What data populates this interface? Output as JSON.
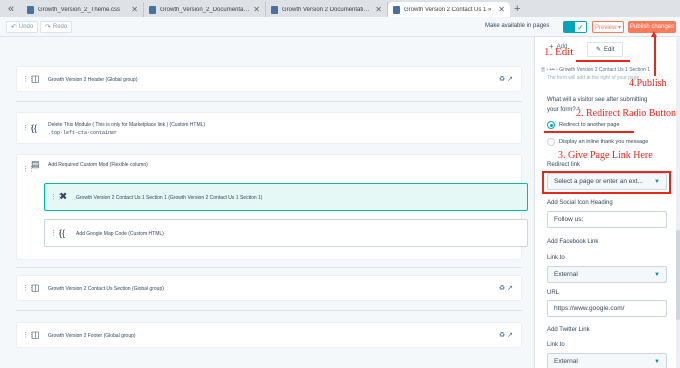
{
  "browser": {
    "tabs": [
      {
        "title": "Growth_Version_2_Theme.css"
      },
      {
        "title": "Growth_Version_2_Documentatio..."
      },
      {
        "title": "Growth Version 2 Documentation ..."
      },
      {
        "title": "Growth Version 2 Contact Us 1 »"
      }
    ],
    "nav_glyph": "«",
    "close_glyph": "✕",
    "new_tab_glyph": "+"
  },
  "toolbar": {
    "undo_label": "Undo",
    "redo_label": "Redo",
    "mobile_label": "Make available in pages",
    "toggle_check": "✓",
    "preview_label": "Preview ▾",
    "publish_label": "Publish changes"
  },
  "canvas": {
    "modules": [
      {
        "label": "Growth Version 2 Header (Global group)"
      },
      {
        "label": "Delete This Module ( This is only for Marketplace link ) (Custom HTML)",
        "sublabel": ".top-left-cta-container"
      },
      {
        "label": "Add Required Custom Mod (Flexible column)"
      },
      {
        "label": "Growth Version 2 Contact Us 1 Section 1 (Growth Version 2 Contact Us 1 Section 1)"
      },
      {
        "label": "Add Google Map Code (Custom HTML)"
      },
      {
        "label": "Growth Version 2 Contact Us Section (Global group)"
      },
      {
        "label": "Growth Version 2 Footer (Global group)"
      }
    ],
    "handle_glyph": "⋮⋮",
    "group_actions": "♻ ↗"
  },
  "panel": {
    "tab_add": "Add",
    "tab_edit": "Edit",
    "plus_glyph": "+",
    "pencil_glyph": "✎",
    "breadcrumb": "🗏 › ••• › Growth Version 2 Contact Us 1 Section 1",
    "faded_text": "The form will add at the right of your page",
    "question": "What will a visitor see after submitting your form? *",
    "option_redirect": "Redirect to another page",
    "option_inline": "Display an inline thank you message",
    "redirect_link_label": "Redirect link",
    "redirect_link_placeholder": "Select a page or enter an ext...",
    "social_heading_label": "Add Social Icon Heading",
    "social_heading_value": "Follow us:",
    "facebook_label": "Add Facebook Link",
    "link_to_label": "Link to",
    "link_to_value": "External",
    "url_label": "URL",
    "url_value": "https://www.google.com/",
    "twitter_label": "Add Twitter Link",
    "link_to_label2": "Link to",
    "link_to_value2": "External",
    "caret_glyph": "▼"
  },
  "annotations": {
    "edit": "1. Edit",
    "redirect": "2. Redirect Radio Button",
    "page_link": "3. Give Page Link Here",
    "publish": "4.Publish"
  },
  "colors": {
    "accent": "#00a4bd",
    "publish": "#ff7a59",
    "annotation": "#e8271b",
    "selected_module": "#e5f8f6"
  }
}
